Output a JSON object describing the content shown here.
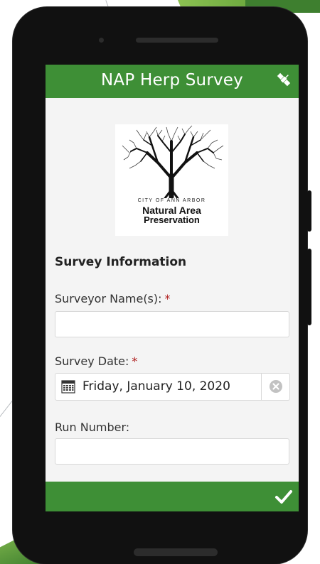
{
  "app": {
    "title": "NAP Herp Survey",
    "accent_color": "#3e8f36",
    "header_icon": "satellite-icon",
    "footer_icon": "checkmark-icon"
  },
  "logo": {
    "line1": "CITY OF ANN ARBOR",
    "line2": "Natural Area",
    "line3": "Preservation",
    "image": "tree-logo"
  },
  "form": {
    "section_title": "Survey Information",
    "surveyor": {
      "label": "Surveyor Name(s):",
      "required_mark": "*",
      "value": ""
    },
    "date": {
      "label": "Survey Date:",
      "required_mark": "*",
      "value": "Friday, January 10, 2020",
      "icon": "calendar-icon",
      "clear_icon": "clear-icon"
    },
    "run_number": {
      "label": "Run Number:",
      "value": ""
    }
  }
}
